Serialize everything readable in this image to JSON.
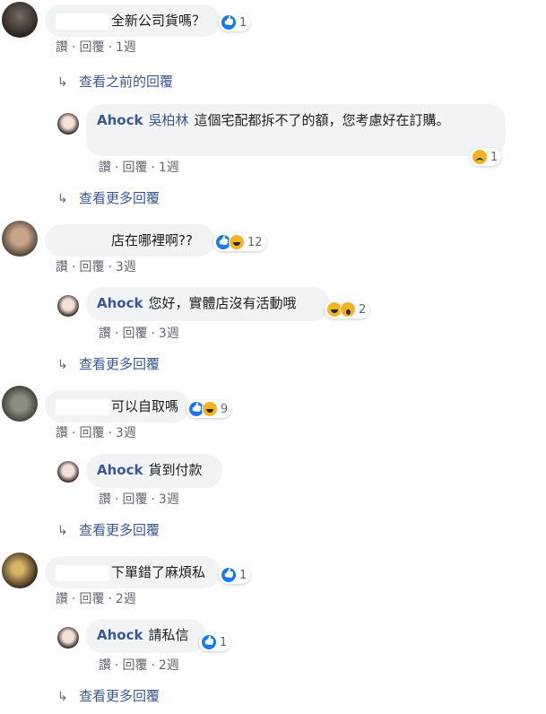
{
  "reply_action": "回覆",
  "like_action": "讚",
  "view_more": "查看更多回覆",
  "view_previous": "查看之前的回覆",
  "page_author": "Ahock",
  "threads": [
    {
      "comment": {
        "text": "全新公司貨嗎？",
        "time": "1週",
        "reaction_count": "1"
      },
      "replies": [
        {
          "author": "Ahock",
          "tag": "吳柏林",
          "text": "這個宅配都拆不了的額，您考慮好在訂購。",
          "time": "1週",
          "reaction_count": "1"
        }
      ]
    },
    {
      "comment": {
        "text": "店在哪裡啊??",
        "time": "3週",
        "reaction_count": "12"
      },
      "replies": [
        {
          "author": "Ahock",
          "text": "您好，實體店沒有活動哦",
          "time": "3週",
          "reaction_count": "2"
        }
      ]
    },
    {
      "comment": {
        "text": "可以自取嗎",
        "time": "3週",
        "reaction_count": "9"
      },
      "replies": [
        {
          "author": "Ahock",
          "text": "貨到付款",
          "time": "3週"
        }
      ]
    },
    {
      "comment": {
        "text": "下單錯了麻煩私",
        "time": "2週",
        "reaction_count": "1"
      },
      "replies": [
        {
          "author": "Ahock",
          "text": "請私信",
          "time": "2週",
          "reaction_count": "1"
        }
      ]
    }
  ],
  "colors": {
    "link": "#385898",
    "bubble": "#f2f3f5",
    "like": "#1877f2",
    "emoji": "#f7b125"
  }
}
